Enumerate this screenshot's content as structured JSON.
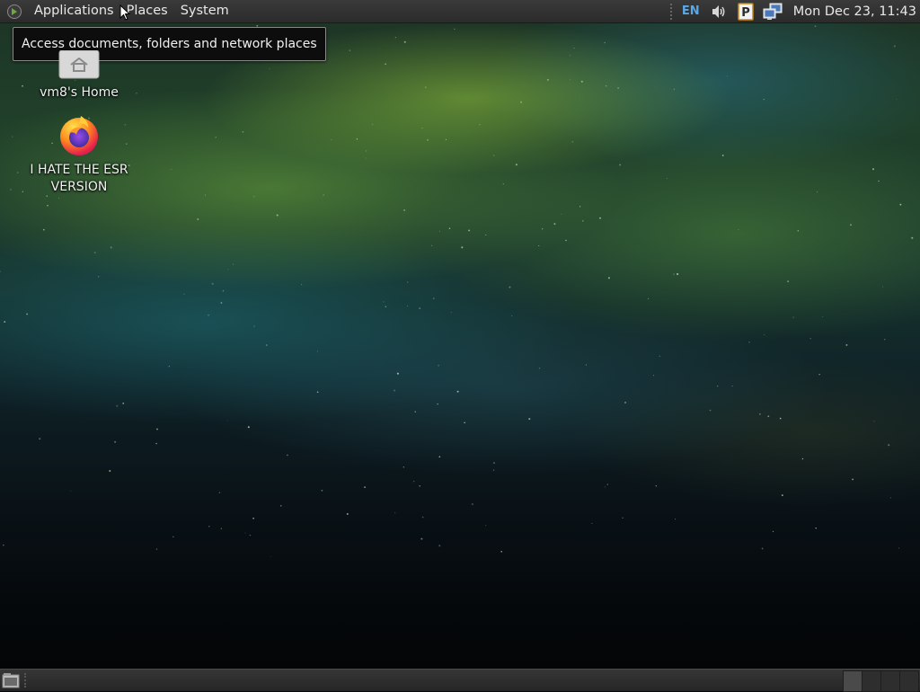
{
  "top_panel": {
    "menus": [
      "Applications",
      "Places",
      "System"
    ],
    "tray": {
      "keyboard_layout": "EN",
      "icons": [
        "volume-icon",
        "parcellite-clipboard-icon",
        "network-icon"
      ],
      "clock": "Mon Dec 23, 11:43"
    }
  },
  "tooltip": {
    "text": "Access documents, folders and network places"
  },
  "desktop": {
    "icons": [
      {
        "label": "vm8's Home",
        "icon": "home-folder-icon"
      },
      {
        "label": "I HATE THE ESR VERSION",
        "icon": "firefox-icon"
      }
    ]
  },
  "bottom_panel": {
    "icons": [
      "show-desktop-icon",
      "workspace-switcher"
    ],
    "workspace_count": 4,
    "active_workspace": 1
  },
  "colors": {
    "panel": "#2b2b2b",
    "keyboard_layout_text": "#5aa8e6",
    "tooltip_bg": "#0d0d0d"
  }
}
